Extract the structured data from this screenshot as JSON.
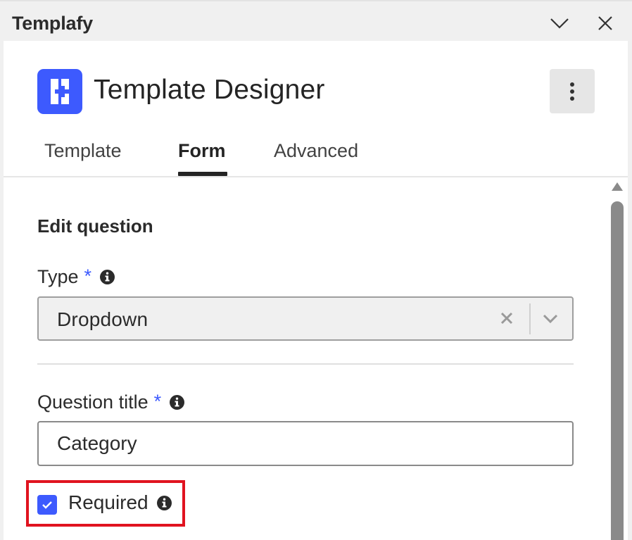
{
  "window": {
    "app_name": "Templafy",
    "icons": {
      "collapse": "chevron-down-icon",
      "close": "close-icon"
    }
  },
  "header": {
    "title": "Template Designer",
    "logo_icon": "templafy-logo",
    "more_icon": "more-vertical-icon",
    "accent_color": "#3d5afe"
  },
  "tabs": [
    {
      "label": "Template",
      "active": false
    },
    {
      "label": "Form",
      "active": true
    },
    {
      "label": "Advanced",
      "active": false
    }
  ],
  "form": {
    "section_title": "Edit question",
    "type": {
      "label": "Type",
      "required_marker": "*",
      "value": "Dropdown"
    },
    "question_title": {
      "label": "Question title",
      "required_marker": "*",
      "value": "Category"
    },
    "required": {
      "label": "Required",
      "checked": true
    }
  },
  "highlight_color": "#e0131f"
}
